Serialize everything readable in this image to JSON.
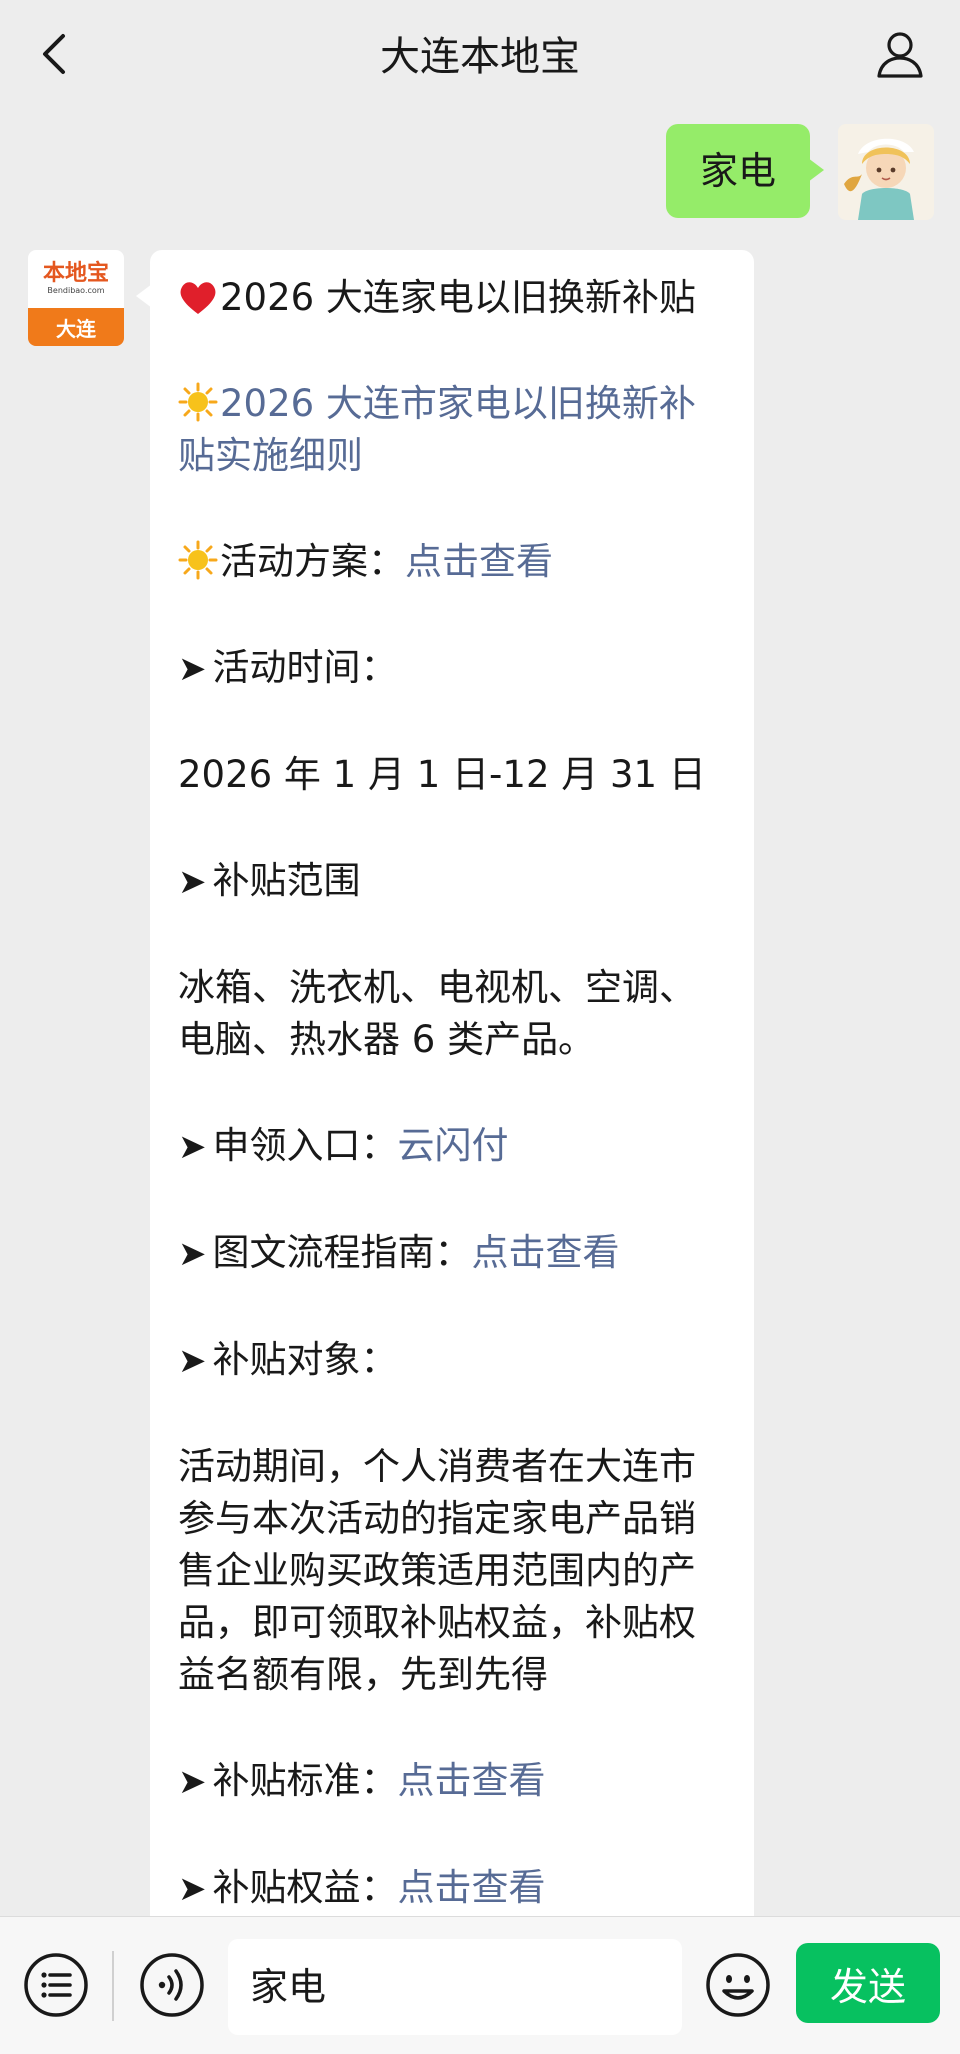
{
  "header": {
    "title": "大连本地宝"
  },
  "outgoing_message": {
    "text": "家电"
  },
  "bot_avatar": {
    "logo_text": "本地宝",
    "logo_sub": "Bendibao.com",
    "city": "大连"
  },
  "reply": {
    "line1": "2026 大连家电以旧换新补贴",
    "line2_link": "2026 大连市家电以旧换新补贴实施细则",
    "plan_label": "活动方案：",
    "plan_link": "点击查看",
    "time_label": "活动时间：",
    "time_value": "2026 年 1 月 1 日-12 月 31 日",
    "scope_label": "补贴范围",
    "scope_value": "冰箱、洗衣机、电视机、空调、电脑、热水器 6 类产品。",
    "entry_label": "申领入口：",
    "entry_link": "云闪付",
    "guide_label": "图文流程指南：",
    "guide_link": "点击查看",
    "target_label": "补贴对象：",
    "target_value": "活动期间，个人消费者在大连市参与本次活动的指定家电产品销售企业购买政策适用范围内的产品，即可领取补贴权益，补贴权益名额有限，先到先得",
    "standard_label": "补贴标准：",
    "standard_link": "点击查看",
    "benefit_label": "补贴权益：",
    "benefit_link": "点击查看"
  },
  "input_bar": {
    "input_value": "家电",
    "send_label": "发送"
  },
  "colors": {
    "link": "#576b95",
    "outgoing_bubble": "#95ec69",
    "send_button": "#07c160"
  }
}
